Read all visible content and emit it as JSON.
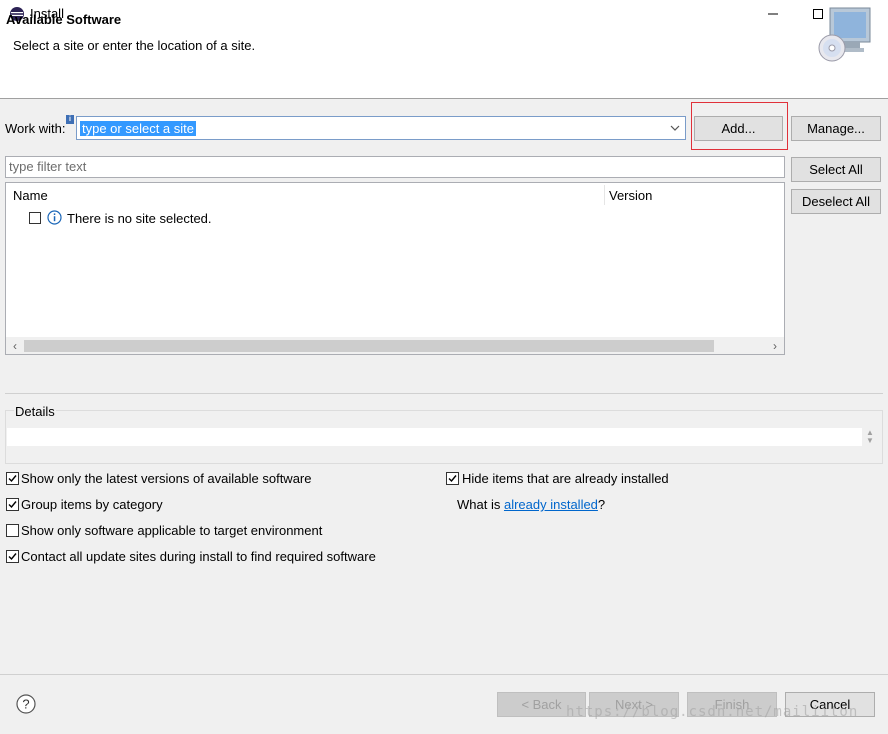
{
  "window": {
    "title": "Install",
    "icon": "eclipse-icon",
    "controls": [
      "minimize-icon",
      "maximize-icon",
      "close-icon"
    ]
  },
  "header": {
    "title": "Available Software",
    "description": "Select a site or enter the location of a site.",
    "image": "install-cd-monitor-icon"
  },
  "work_with": {
    "label": "Work with:",
    "info_marker": "i",
    "value": "type or select a site",
    "add_button": "Add...",
    "manage_button": "Manage..."
  },
  "filter": {
    "placeholder": "type filter text"
  },
  "buttons": {
    "select_all": "Select All",
    "deselect_all": "Deselect All"
  },
  "table": {
    "columns": [
      "Name",
      "Version"
    ],
    "rows": [
      {
        "checked": false,
        "icon": "info-icon",
        "text": "There is no site selected."
      }
    ]
  },
  "details": {
    "label": "Details",
    "value": ""
  },
  "options": {
    "latest_versions": {
      "label": "Show only the latest versions of available software",
      "checked": true
    },
    "group_by_category": {
      "label": "Group items by category",
      "checked": true
    },
    "target_env": {
      "label": "Show only software applicable to target environment",
      "checked": false
    },
    "contact_sites": {
      "label": "Contact all update sites during install to find required software",
      "checked": true
    },
    "hide_installed": {
      "label": "Hide items that are already installed",
      "checked": true
    },
    "what_is_prefix": "What is ",
    "what_is_link": "already installed",
    "what_is_suffix": "?"
  },
  "footer": {
    "help": "?",
    "back": "< Back",
    "next": "Next >",
    "finish": "Finish",
    "cancel": "Cancel",
    "watermark": "https://blog.csdn.net/mailiiton"
  },
  "colors": {
    "selection": "#3399ff",
    "highlight_box": "#e0313a",
    "link": "#0066cc",
    "info_blue": "#1a66b8"
  }
}
